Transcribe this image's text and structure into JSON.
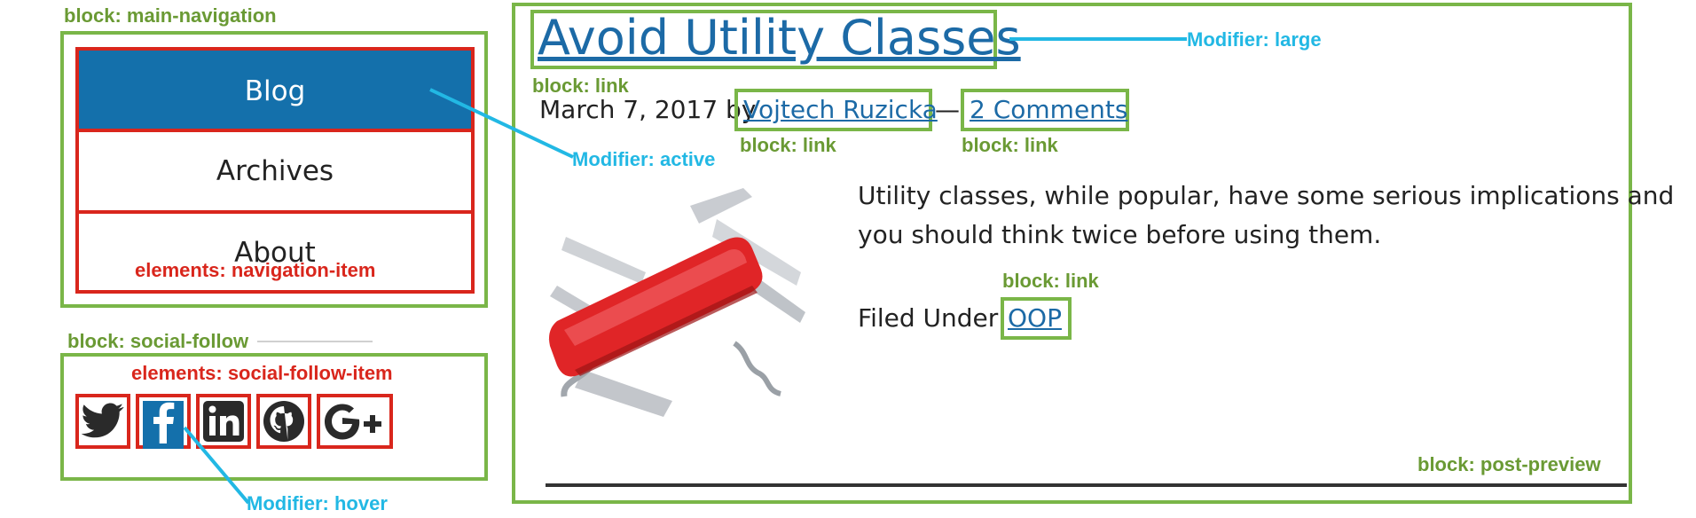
{
  "nav": {
    "block_label": "block: main-navigation",
    "items": [
      {
        "label": "Blog"
      },
      {
        "label": "Archives"
      },
      {
        "label": "About"
      }
    ],
    "elements_label": "elements: navigation-item",
    "active_modifier": "Modifier: active"
  },
  "social": {
    "block_label": "block: social-follow",
    "elements_label": "elements: social-follow-item",
    "hover_modifier": "Modifier: hover",
    "icons": [
      "twitter-icon",
      "facebook-icon",
      "linkedin-icon",
      "github-icon",
      "google-plus-icon"
    ]
  },
  "post": {
    "title": "Avoid Utility Classes",
    "title_modifier": "Modifier: large",
    "title_block_label": "block: link",
    "date_prefix": "March 7, 2017 by",
    "author": "Vojtech Ruzicka",
    "dash": "—",
    "comments": "2 Comments",
    "author_block_label": "block: link",
    "comments_block_label": "block: link",
    "excerpt_line1": "Utility classes, while popular, have some serious implications and",
    "excerpt_line2": "you should think twice before using them.",
    "category_block_label": "block: link",
    "filed_under": "Filed Under:",
    "category": "OOP",
    "block_label": "block: post-preview"
  },
  "colors": {
    "block_green": "#7ab648",
    "element_red": "#d9261c",
    "modifier_blue": "#22b8e4",
    "active_bg": "#1470ab",
    "link_blue": "#1c6aa6"
  }
}
